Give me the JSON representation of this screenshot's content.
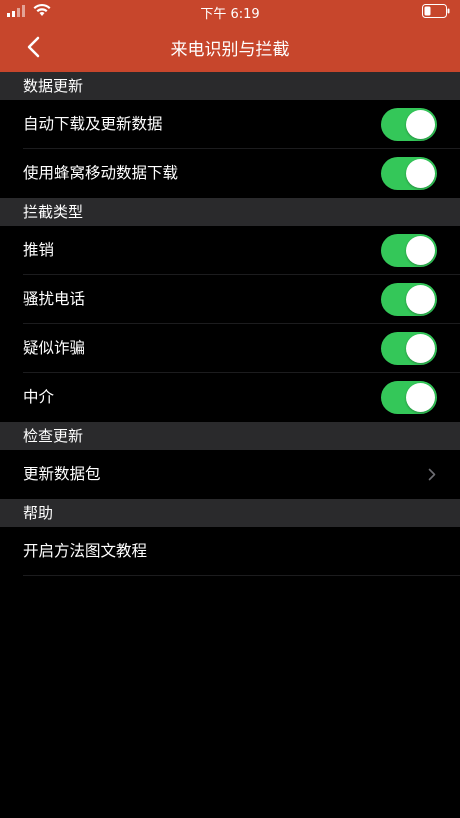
{
  "status_bar": {
    "time": "下午 6:19"
  },
  "nav": {
    "title": "来电识别与拦截",
    "back_icon": "chevron-left-icon"
  },
  "sections": [
    {
      "header": "数据更新",
      "rows": [
        {
          "label": "自动下载及更新数据",
          "toggle": true
        },
        {
          "label": "使用蜂窝移动数据下载",
          "toggle": true
        }
      ]
    },
    {
      "header": "拦截类型",
      "rows": [
        {
          "label": "推销",
          "toggle": true
        },
        {
          "label": "骚扰电话",
          "toggle": true
        },
        {
          "label": "疑似诈骗",
          "toggle": true
        },
        {
          "label": "中介",
          "toggle": true
        }
      ]
    },
    {
      "header": "检查更新",
      "rows": [
        {
          "label": "更新数据包",
          "chevron": true
        }
      ]
    },
    {
      "header": "帮助",
      "rows": [
        {
          "label": "开启方法图文教程"
        }
      ]
    }
  ],
  "colors": {
    "header_bg": "#c7462c",
    "section_bg": "#2a2a2c",
    "toggle_on": "#34c759",
    "background": "#000000"
  }
}
